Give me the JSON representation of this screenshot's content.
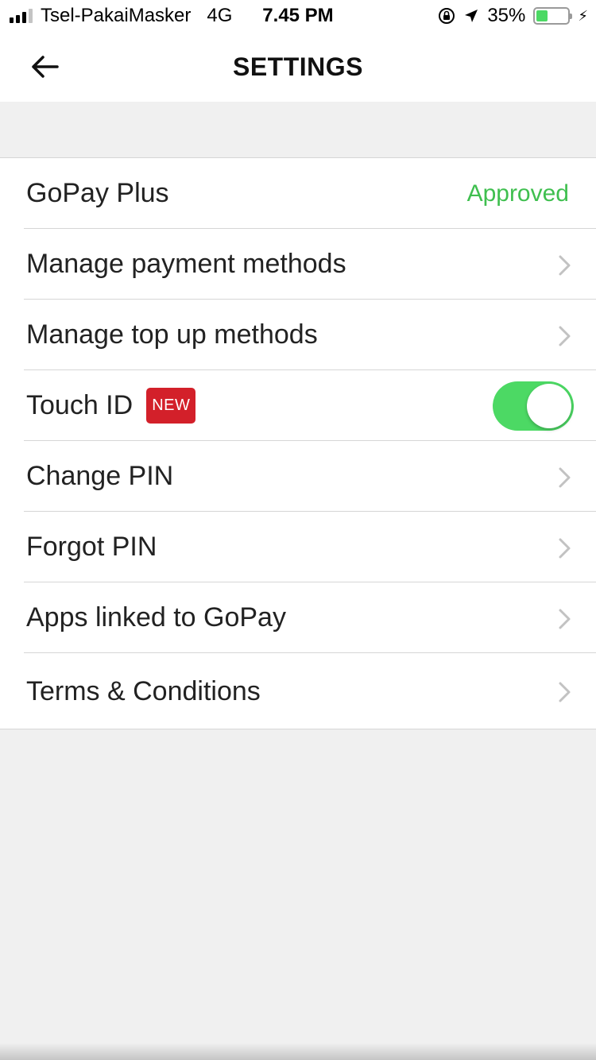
{
  "status_bar": {
    "carrier": "Tsel-PakaiMasker",
    "network": "4G",
    "time": "7.45 PM",
    "battery": "35%",
    "battery_level": 0.35
  },
  "header": {
    "title": "SETTINGS"
  },
  "settings": {
    "items": [
      {
        "label": "GoPay Plus",
        "value": "Approved"
      },
      {
        "label": "Manage payment methods"
      },
      {
        "label": "Manage top up methods"
      },
      {
        "label": "Touch ID",
        "badge": "NEW",
        "toggle_on": true
      },
      {
        "label": "Change PIN"
      },
      {
        "label": "Forgot PIN"
      },
      {
        "label": "Apps linked to GoPay"
      },
      {
        "label": "Terms & Conditions"
      }
    ]
  },
  "colors": {
    "approved": "#3fbf4f",
    "toggle_on": "#4cd964",
    "badge": "#d3202a"
  }
}
